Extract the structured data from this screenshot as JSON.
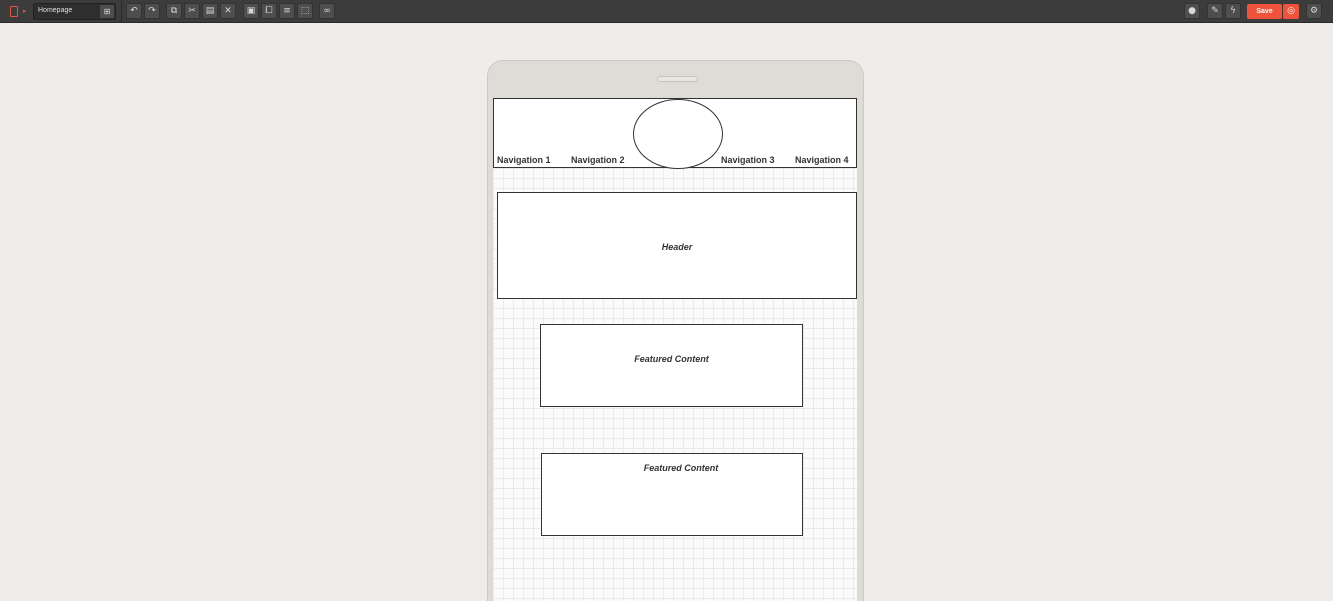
{
  "toolbar": {
    "page_name": "Homepage",
    "save_label": "Save",
    "icons": {
      "device": "tablet-icon",
      "sitemap": "sitemap-icon",
      "undo": "undo-icon",
      "redo": "redo-icon",
      "copy": "copy-icon",
      "cut": "scissors-icon",
      "paste": "paste-icon",
      "delete": "delete-icon",
      "lock": "lock-icon",
      "group": "group-icon",
      "align": "align-icon",
      "select": "select-area-icon",
      "link": "link-icon",
      "comment": "comment-icon",
      "edit": "edit-icon",
      "lightning": "lightning-icon",
      "preview": "preview-icon",
      "settings": "settings-icon"
    },
    "accent_color": "#f1533a"
  },
  "canvas": {
    "nav_items": [
      "Navigation 1",
      "Navigation 2",
      "Navigation 3",
      "Navigation 4"
    ],
    "header_label": "Header",
    "featured_1_label": "Featured Content",
    "featured_2_label": "Featured Content"
  }
}
